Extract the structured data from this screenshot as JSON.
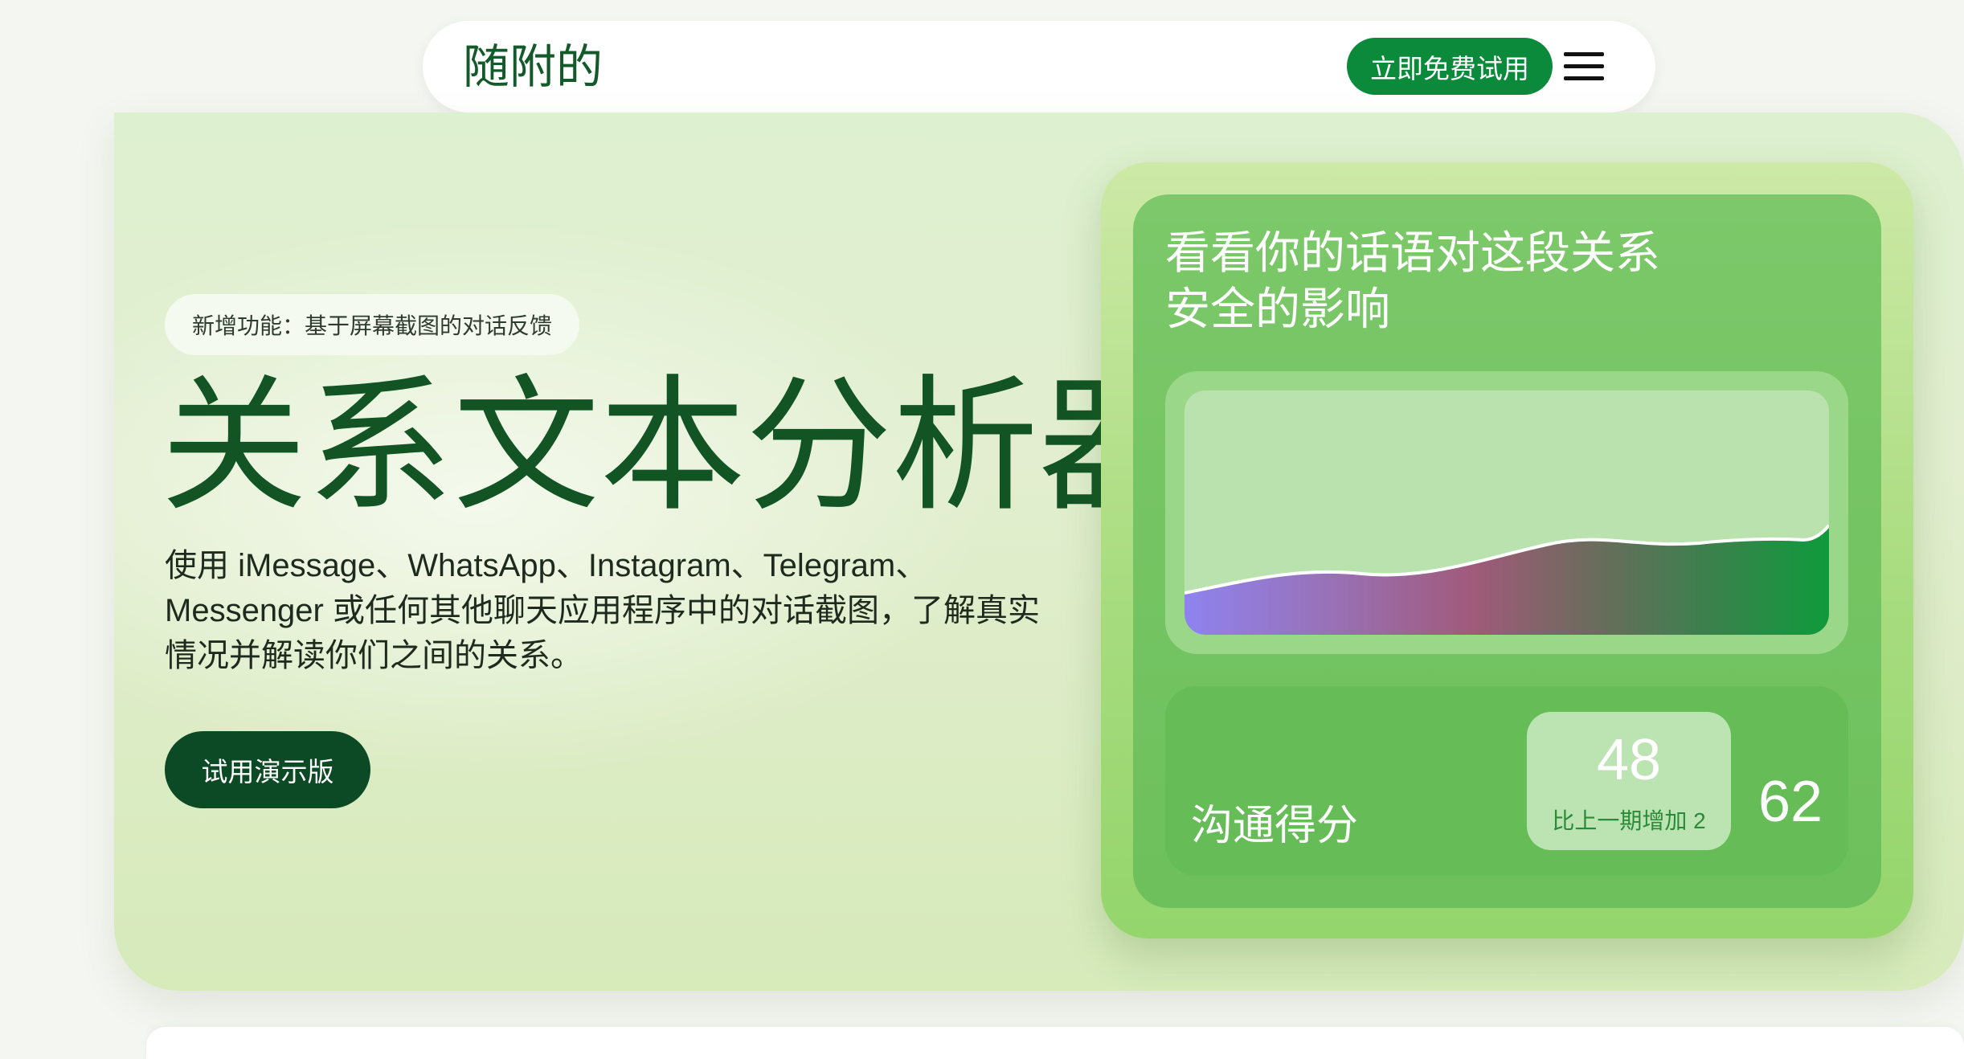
{
  "nav": {
    "brand": "随附的",
    "cta_label": "立即免费试用",
    "menu_icon": "hamburger-menu-icon"
  },
  "hero": {
    "badge": "新增功能：基于屏幕截图的对话反馈",
    "title": "关系文本分析器",
    "description": "使用 iMessage、WhatsApp、Instagram、Telegram、Messenger 或任何其他聊天应用程序中的对话截图，了解真实情况并解读你们之间的关系。",
    "demo_button": "试用演示版"
  },
  "widget": {
    "title": "看看你的话语对这段关系安全的影响",
    "score_label": "沟通得分",
    "score_current": "48",
    "score_change": "比上一期增加 2",
    "score_previous": "62",
    "colors": {
      "gradient_start": "#8e83ef",
      "gradient_mid": "#a05a7a",
      "gradient_end": "#0f9a3c",
      "accent": "#0a8a3a"
    }
  }
}
